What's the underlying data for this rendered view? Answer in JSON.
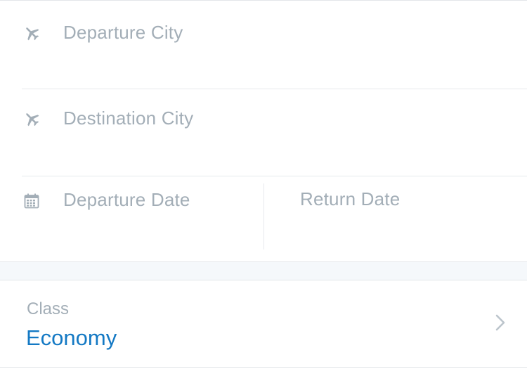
{
  "form": {
    "departure_city": {
      "placeholder": "Departure City",
      "icon": "plane-icon"
    },
    "destination_city": {
      "placeholder": "Destination City",
      "icon": "plane-icon"
    },
    "departure_date": {
      "placeholder": "Departure Date",
      "icon": "calendar-icon"
    },
    "return_date": {
      "placeholder": "Return Date"
    }
  },
  "travel_class": {
    "label": "Class",
    "value": "Economy",
    "icon": "chevron-right-icon"
  },
  "colors": {
    "placeholder": "#a3aeb7",
    "accent": "#1479c4",
    "divider": "#e6e9ec",
    "band": "#f5f8fb"
  }
}
